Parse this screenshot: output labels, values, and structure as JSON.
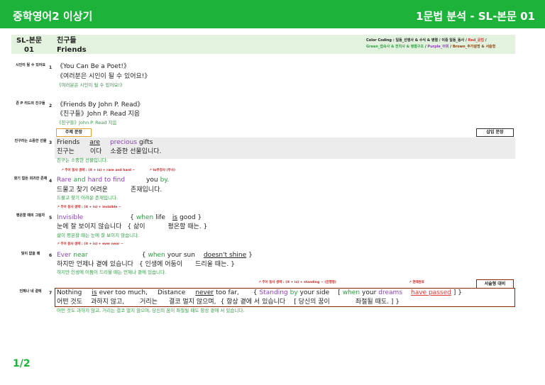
{
  "header": {
    "left": "중학영어2 이상기",
    "right": "1문법 분석 - SL-본문 01"
  },
  "title_band": {
    "id_line1": "SL-본문",
    "id_line2": "01",
    "title_ko": "친구들",
    "title_en": "Friends",
    "color_line1_a": "Color Coding : 일동_선행사 & 수식 & 병렬 / 이중 일동_동사 / ",
    "color_line1_b": "Red_문법",
    "color_line1_c": " /",
    "color_line2_a": "Green_접속사 & 전치사 & 병렬구조",
    "color_line2_b": " / ",
    "color_line2_c": "Purple_어휘",
    "color_line2_d": " / ",
    "color_line2_e": "Brown_추가설명 & 서술형"
  },
  "buttons": {
    "theme": "주제 문장",
    "insert": "삽입 문장",
    "descriptive": "서술형 대비"
  },
  "rows": {
    "r1": {
      "side": "시인이 될 수 있어요",
      "num": "1",
      "en": "《You Can Be a Poet!》",
      "ko": "《여러분은 시인이 될 수 있어요!》",
      "tr": "《여러분은 시인이 될 수 있어요!》"
    },
    "r2": {
      "side": "존 P 리드의 친구들",
      "num": "2",
      "en": "《Friends By John P. Read》",
      "ko": "《친구들》John P. Read 지음",
      "tr": "《친구들》John P. Read 지음"
    },
    "r3": {
      "side": "친구라는 소중한 선물",
      "num": "3",
      "w1": "Friends",
      "w2": "are",
      "w3": "precious",
      "w4": "gifts",
      "k1": "친구는",
      "k2": "이다",
      "k3": "소중한 선물입니다.",
      "tr": "친구는 소중한 선물입니다."
    },
    "r4": {
      "side": "찾기 힘든 희귀한 존재",
      "num": "4",
      "ann1": "주어 동사 생략 : (it + is) + rare and hard ~",
      "ann2": "to부정사 (부사)",
      "w1": "Rare",
      "w2": "and",
      "w3": "hard",
      "w4": "to find",
      "w5": "you",
      "w6": "by.",
      "k1": "드물고 찾기 어려운",
      "k2": "존재입니다.",
      "tr": "드물고 찾기 어려운 존재입니다."
    },
    "r5": {
      "side": "평온할 때의 그림자",
      "num": "5",
      "ann1": "주어 동사 생략 : (it + is) + invisible ~",
      "w1": "Invisible",
      "w2": "{",
      "w3": "when",
      "w4": "life",
      "w5": "is",
      "w6": "good }",
      "k1": "눈에 잘 보이지 않습니다",
      "k2": "{ 삶이",
      "k3": "평온할 때는. }",
      "tr": "삶이 평온할 때는 눈에 잘 보이지 않습니다."
    },
    "r6": {
      "side": "빛이 없을 때",
      "num": "6",
      "ann1": "주어 동사 생략 : (it + is) + ever near ~",
      "w1": "Ever",
      "w2": "near",
      "w3": "{",
      "w4": "when",
      "w5": "your sun",
      "w6": "doesn't shine",
      "w7": "}",
      "k1": "하지만 언제나 곁에 있습니다",
      "k2": "{ 인생에 어둠이",
      "k3": "드리울 때는. }",
      "tr": "하지만 인생에 어둠이 드리울 때는 언제나 곁에 있습니다."
    },
    "r7": {
      "side": "언제나 네 곁에",
      "num": "7",
      "ann1": "주어 동사 생략 : (it + is) + standing ~ (진행형)",
      "ann2": "현재완료",
      "w1": "Nothing",
      "w2": "is",
      "w3": "ever too much,",
      "w4": "Distance",
      "w5": "never",
      "w6": "too far,",
      "w7": "{",
      "w8": "Standing",
      "w9": "by",
      "w10": "your side",
      "w11": "[",
      "w12": "when",
      "w13": "your",
      "w14": "dreams",
      "w15": "have passed",
      "w16": "] }",
      "k1": "어떤 것도",
      "k2": "과하지 않고,",
      "k3": "거리는",
      "k4": "결코 멀지 않으며,",
      "k5": "{ 항상 곁에 서 있습니다",
      "k6": "[ 당신의 꿈이",
      "k7": "좌절될 때도. ] }",
      "tr": "어떤 것도 과하지 않고, 거리는 결코 멀지 않으며, 당신의 꿈이 좌절될 때도 항상 곁에 서 있습니다."
    }
  },
  "pager": "1/2",
  "colors": {
    "header": "#1db33a",
    "band": "#e2f2de",
    "red": "#e53935",
    "green": "#2ea043",
    "purple": "#8e3fbf",
    "brown": "#8b4513"
  },
  "icons": {
    "annotation_arrow": "red-curved-arrow-icon"
  }
}
